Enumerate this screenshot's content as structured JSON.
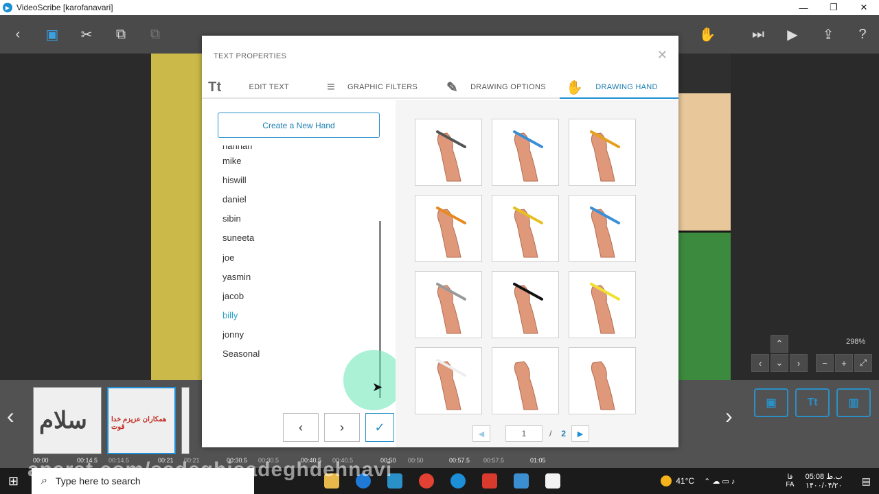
{
  "window": {
    "title": "VideoScribe [karofanavari]"
  },
  "canvas": {
    "zoom": "298%"
  },
  "modal": {
    "title": "TEXT PROPERTIES",
    "tabs": [
      {
        "label": "EDIT TEXT",
        "icon": "text-icon",
        "glyph": "Tt"
      },
      {
        "label": "GRAPHIC FILTERS",
        "icon": "filters-icon",
        "glyph": "≡"
      },
      {
        "label": "DRAWING OPTIONS",
        "icon": "pencil-icon",
        "glyph": "✎"
      },
      {
        "label": "DRAWING HAND",
        "icon": "hand-icon",
        "glyph": "✋"
      }
    ],
    "active_tab": "DRAWING HAND",
    "create_button": "Create a New Hand",
    "hands": [
      "hannah",
      "mike",
      "hiswill",
      "daniel",
      "sibin",
      "suneeta",
      "joe",
      "yasmin",
      "jacob",
      "billy",
      "jonny",
      "Seasonal"
    ],
    "selected_hand": "billy",
    "pager": {
      "current": "1",
      "separator": "/",
      "total": "2"
    },
    "grid_items": [
      {
        "tool": "grey pen"
      },
      {
        "tool": "blue pen"
      },
      {
        "tool": "pencil"
      },
      {
        "tool": "orange pencil"
      },
      {
        "tool": "yellow pencil"
      },
      {
        "tool": "blue marker"
      },
      {
        "tool": "silver marker"
      },
      {
        "tool": "black marker"
      },
      {
        "tool": "yellow highlighter"
      },
      {
        "tool": "chalk"
      },
      {
        "tool": "pointing finger"
      },
      {
        "tool": "open hand"
      }
    ]
  },
  "timeline": {
    "timestamps": [
      "00:00",
      "00:14.5",
      "00:14.5",
      "00:21",
      "00:21",
      "00:30.5",
      "00:30.5",
      "00:40.5",
      "00:40.5",
      "00:50",
      "00:50",
      "00:57.5",
      "00:57.5",
      "01:05"
    ],
    "thumb1_text": "سلام",
    "thumb2_text": "همکاران عزیزم خدا قوت"
  },
  "taskbar": {
    "search_placeholder": "Type here to search",
    "temperature": "41°C",
    "lang": "FA",
    "time": "05:08 ب.ظ",
    "date": "۱۴۰۰/۰۴/۲۰",
    "lang2": "فا"
  },
  "watermark": "aparat.com/sadeghisadeghdehnavi",
  "colors": {
    "accent": "#1c8fd6",
    "selected_text": "#2a9fc8"
  }
}
